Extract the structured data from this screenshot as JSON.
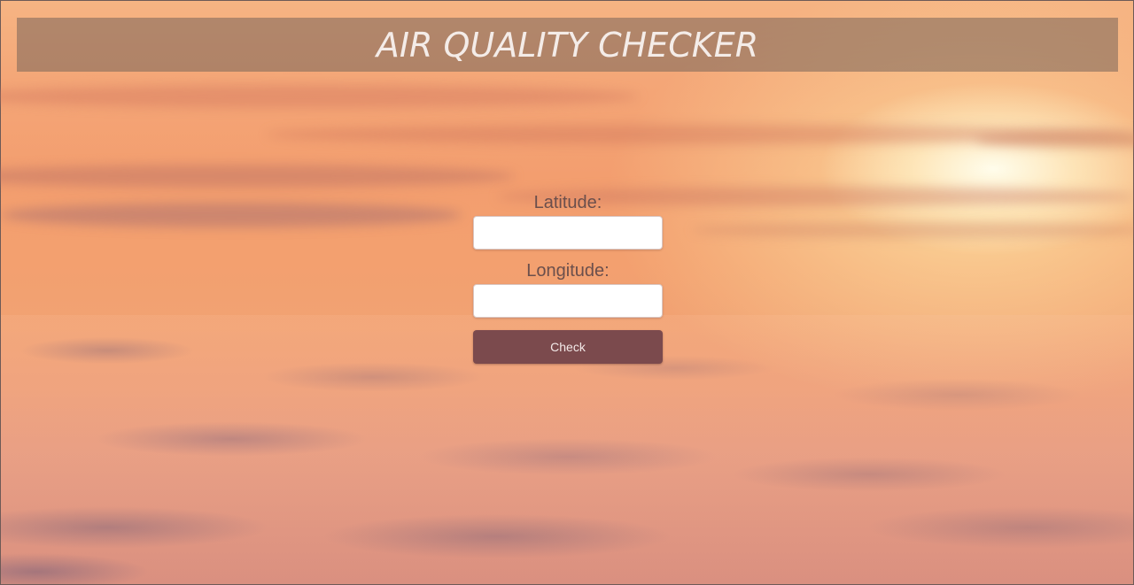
{
  "header": {
    "title": "AIR QUALITY CHECKER"
  },
  "form": {
    "latitude_label": "Latitude:",
    "latitude_value": "",
    "longitude_label": "Longitude:",
    "longitude_value": "",
    "check_label": "Check"
  },
  "colors": {
    "button": "#7b4a4d",
    "header_bg": "#78645a",
    "label_text": "#6b4f4c"
  }
}
